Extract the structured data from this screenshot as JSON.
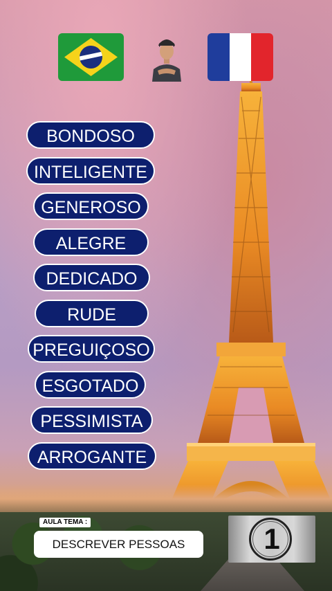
{
  "header": {
    "source_language_flag": "brazil-flag-icon",
    "target_language_flag": "france-flag-icon",
    "avatar": "teacher-avatar"
  },
  "words": [
    "BONDOSO",
    "INTELIGENTE",
    "GENEROSO",
    "ALEGRE",
    "DEDICADO",
    "RUDE",
    "PREGUIÇOSO",
    "ESGOTADO",
    "PESSIMISTA",
    "ARROGANTE"
  ],
  "lesson": {
    "label": "AULA TEMA :",
    "topic": "DESCREVER PESSOAS"
  },
  "counter": {
    "value": "1"
  },
  "colors": {
    "pill_background": "#0d1f6e",
    "pill_border": "#ffffff",
    "pill_text": "#ffffff"
  }
}
